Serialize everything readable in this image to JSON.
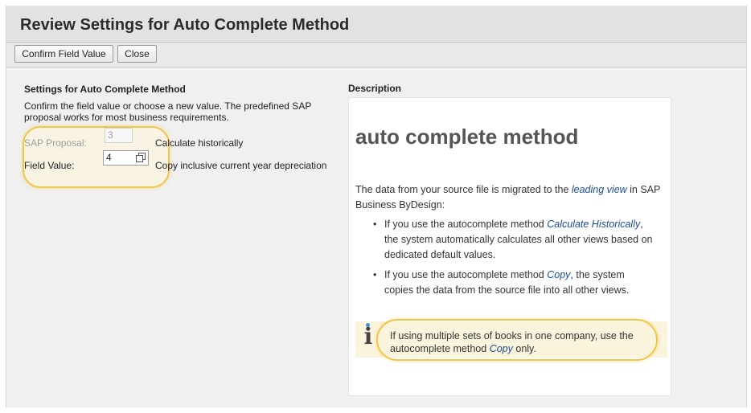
{
  "window": {
    "title": "Review Settings for Auto Complete Method"
  },
  "toolbar": {
    "confirm_label": "Confirm Field Value",
    "close_label": "Close"
  },
  "settings": {
    "section_title": "Settings for Auto Complete Method",
    "intro": "Confirm the field value or choose a new value. The predefined SAP proposal works for most business requirements.",
    "proposal_label": "SAP Proposal:",
    "proposal_value": "3",
    "proposal_desc": "Calculate historically",
    "field_label": "Field Value:",
    "field_value": "4",
    "field_desc": "Copy inclusive current year depreciation",
    "copy_icon": "copy-icon"
  },
  "description": {
    "header": "Description",
    "heading": "auto complete method",
    "para_part1": "The data from your source file is migrated to the ",
    "para_link": "leading view",
    "para_part2": " in SAP Business ByDesign:",
    "bullet1_part1": "If you use the autocomplete method ",
    "bullet1_link": "Calculate Historically",
    "bullet1_part2": ", the system automatically calculates all other views based on dedicated default values.",
    "bullet2_part1": "If you use the autocomplete method ",
    "bullet2_link": "Copy",
    "bullet2_part2": ", the system copies the data from the source file into all other views.",
    "note_part1": "If using multiple sets of books in one company, use the autocomplete method ",
    "note_link": "Copy",
    "note_part2": " only.",
    "info_icon": "info-icon",
    "bullet_glyph": "•",
    "info_glyph": "i"
  },
  "colors": {
    "highlight": "#f0c64a",
    "link": "#1a4d93",
    "background": "#f0f0f0"
  }
}
